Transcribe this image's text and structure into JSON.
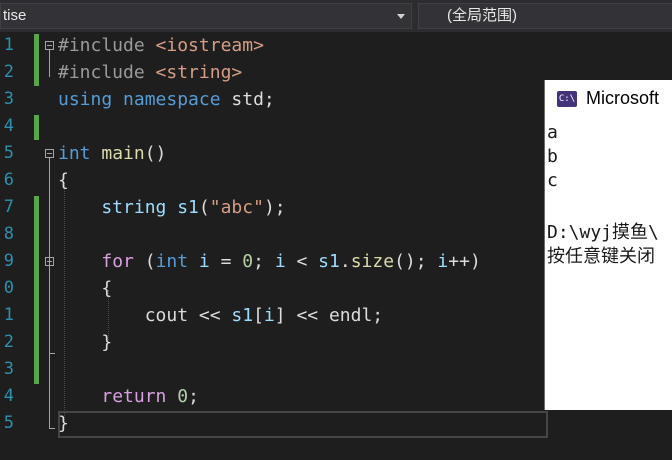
{
  "toolbar": {
    "scope_combo_text": "tise",
    "range_combo_text": "(全局范围)"
  },
  "editor": {
    "line_numbers": [
      "1",
      "2",
      "3",
      "4",
      "5",
      "6",
      "7",
      "8",
      "9",
      "0",
      "1",
      "2",
      "3",
      "4",
      "5"
    ],
    "lines": [
      [
        {
          "t": "#include ",
          "c": "pp"
        },
        {
          "t": "<iostream>",
          "c": "hdr"
        }
      ],
      [
        {
          "t": "#include ",
          "c": "pp"
        },
        {
          "t": "<string>",
          "c": "hdr"
        }
      ],
      [
        {
          "t": "using",
          "c": "kw"
        },
        {
          "t": " ",
          "c": ""
        },
        {
          "t": "namespace",
          "c": "kw"
        },
        {
          "t": " std;",
          "c": ""
        }
      ],
      [],
      [
        {
          "t": "int",
          "c": "kw"
        },
        {
          "t": " ",
          "c": ""
        },
        {
          "t": "main",
          "c": "fn"
        },
        {
          "t": "()",
          "c": ""
        }
      ],
      [
        {
          "t": "{",
          "c": ""
        }
      ],
      [
        {
          "t": "    string ",
          "c": "var"
        },
        {
          "t": "s1",
          "c": "var"
        },
        {
          "t": "(",
          "c": ""
        },
        {
          "t": "\"abc\"",
          "c": "str"
        },
        {
          "t": ");",
          "c": ""
        }
      ],
      [],
      [
        {
          "t": "    ",
          "c": ""
        },
        {
          "t": "for",
          "c": "ctl"
        },
        {
          "t": " (",
          "c": ""
        },
        {
          "t": "int",
          "c": "kw"
        },
        {
          "t": " ",
          "c": ""
        },
        {
          "t": "i",
          "c": "var"
        },
        {
          "t": " = ",
          "c": ""
        },
        {
          "t": "0",
          "c": "num"
        },
        {
          "t": "; ",
          "c": ""
        },
        {
          "t": "i",
          "c": "var"
        },
        {
          "t": " < ",
          "c": ""
        },
        {
          "t": "s1",
          "c": "var"
        },
        {
          "t": ".",
          "c": ""
        },
        {
          "t": "size",
          "c": "fn"
        },
        {
          "t": "(); ",
          "c": ""
        },
        {
          "t": "i",
          "c": "var"
        },
        {
          "t": "++)",
          "c": ""
        }
      ],
      [
        {
          "t": "    {",
          "c": ""
        }
      ],
      [
        {
          "t": "        cout << ",
          "c": ""
        },
        {
          "t": "s1",
          "c": "var"
        },
        {
          "t": "[",
          "c": ""
        },
        {
          "t": "i",
          "c": "var"
        },
        {
          "t": "] << endl;",
          "c": ""
        }
      ],
      [
        {
          "t": "    }",
          "c": ""
        }
      ],
      [],
      [
        {
          "t": "    ",
          "c": ""
        },
        {
          "t": "return",
          "c": "ctl"
        },
        {
          "t": " ",
          "c": ""
        },
        {
          "t": "0",
          "c": "num"
        },
        {
          "t": ";",
          "c": ""
        }
      ],
      [
        {
          "t": "}",
          "c": ""
        }
      ]
    ]
  },
  "console": {
    "title": "Microsoft",
    "icon_text": "C:\\",
    "output_lines": [
      "a",
      "b",
      "c",
      "",
      "D:\\wyj摸鱼\\",
      "按任意键关闭"
    ]
  },
  "colors": {
    "line_number": "#2b91af",
    "keyword": "#569cd6",
    "control": "#d8a0df",
    "string": "#d69d85",
    "function": "#dcdcaa",
    "variable": "#9cdcfe",
    "number": "#b5cea8",
    "change_bar": "#57a64a"
  }
}
